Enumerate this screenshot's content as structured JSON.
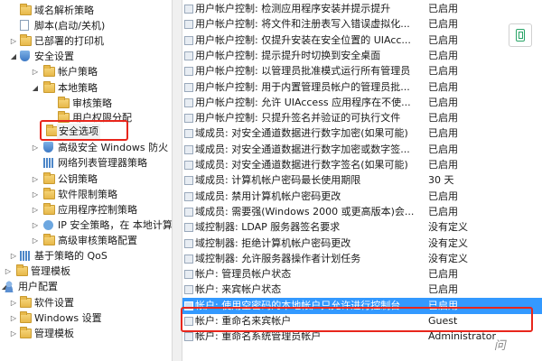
{
  "tree": [
    {
      "label": "域名解析策略",
      "icon": "folder",
      "expander": ""
    },
    {
      "label": "脚本(启动/关机)",
      "icon": "doc",
      "expander": ""
    },
    {
      "label": "已部署的打印机",
      "icon": "folder",
      "expander": "▷"
    },
    {
      "label": "安全设置",
      "icon": "shield",
      "expander": "◢"
    },
    {
      "label": "帐户策略",
      "icon": "folder",
      "expander": "▷"
    },
    {
      "label": "本地策略",
      "icon": "folder",
      "expander": "◢"
    },
    {
      "label": "审核策略",
      "icon": "folder",
      "expander": ""
    },
    {
      "label": "用户权限分配",
      "icon": "folder",
      "expander": ""
    },
    {
      "label": "安全选项",
      "icon": "folder",
      "expander": ""
    },
    {
      "label": "高级安全 Windows 防火",
      "icon": "shield",
      "expander": "▷"
    },
    {
      "label": "网络列表管理器策略",
      "icon": "bars",
      "expander": ""
    },
    {
      "label": "公钥策略",
      "icon": "folder",
      "expander": "▷"
    },
    {
      "label": "软件限制策略",
      "icon": "folder",
      "expander": "▷"
    },
    {
      "label": "应用程序控制策略",
      "icon": "folder",
      "expander": "▷"
    },
    {
      "label": "IP 安全策略，在 本地计算",
      "icon": "net",
      "expander": "▷"
    },
    {
      "label": "高级审核策略配置",
      "icon": "folder",
      "expander": "▷"
    },
    {
      "label": "基于策略的 QoS",
      "icon": "bars",
      "expander": "▷"
    },
    {
      "label": "管理模板",
      "icon": "folder",
      "expander": "▷"
    },
    {
      "label": "用户配置",
      "icon": "user",
      "expander": "◢"
    },
    {
      "label": "软件设置",
      "icon": "folder",
      "expander": "▷"
    },
    {
      "label": "Windows 设置",
      "icon": "folder",
      "expander": "▷"
    },
    {
      "label": "管理模板",
      "icon": "folder",
      "expander": "▷"
    }
  ],
  "policies": [
    {
      "name": "用户帐户控制: 检测应用程序安装并提示提升",
      "value": "已启用"
    },
    {
      "name": "用户帐户控制: 将文件和注册表写入错误虚拟化...",
      "value": "已启用"
    },
    {
      "name": "用户帐户控制: 仅提升安装在安全位置的 UIAcc...",
      "value": "已启用"
    },
    {
      "name": "用户帐户控制: 提示提升时切换到安全桌面",
      "value": "已启用"
    },
    {
      "name": "用户帐户控制: 以管理员批准模式运行所有管理员",
      "value": "已启用"
    },
    {
      "name": "用户帐户控制: 用于内置管理员帐户的管理员批...",
      "value": "已启用"
    },
    {
      "name": "用户帐户控制: 允许 UIAccess 应用程序在不使...",
      "value": "已启用"
    },
    {
      "name": "用户帐户控制: 只提升签名并验证的可执行文件",
      "value": "已启用"
    },
    {
      "name": "域成员: 对安全通道数据进行数字加密(如果可能)",
      "value": "已启用"
    },
    {
      "name": "域成员: 对安全通道数据进行数字加密或数字签...",
      "value": "已启用"
    },
    {
      "name": "域成员: 对安全通道数据进行数字签名(如果可能)",
      "value": "已启用"
    },
    {
      "name": "域成员: 计算机帐户密码最长使用期限",
      "value": "30 天"
    },
    {
      "name": "域成员: 禁用计算机帐户密码更改",
      "value": "已启用"
    },
    {
      "name": "域成员: 需要强(Windows 2000 或更高版本)会...",
      "value": "已启用"
    },
    {
      "name": "域控制器: LDAP 服务器签名要求",
      "value": "没有定义"
    },
    {
      "name": "域控制器: 拒绝计算机帐户密码更改",
      "value": "没有定义"
    },
    {
      "name": "域控制器: 允许服务器操作者计划任务",
      "value": "没有定义"
    },
    {
      "name": "帐户: 管理员帐户状态",
      "value": "已启用"
    },
    {
      "name": "帐户: 来宾帐户状态",
      "value": "已启用"
    },
    {
      "name": "帐户: 使用空密码的本地帐户只允许进行控制台...",
      "value": "已启用"
    },
    {
      "name": "帐户: 重命名来宾帐户",
      "value": "Guest"
    },
    {
      "name": "帐户: 重命名系统管理员帐户",
      "value": "Administrator"
    }
  ],
  "watermark": "问",
  "colors": {
    "selection": "#3399ff",
    "highlight_box": "#e8261c",
    "accent_green": "#2aa568"
  }
}
